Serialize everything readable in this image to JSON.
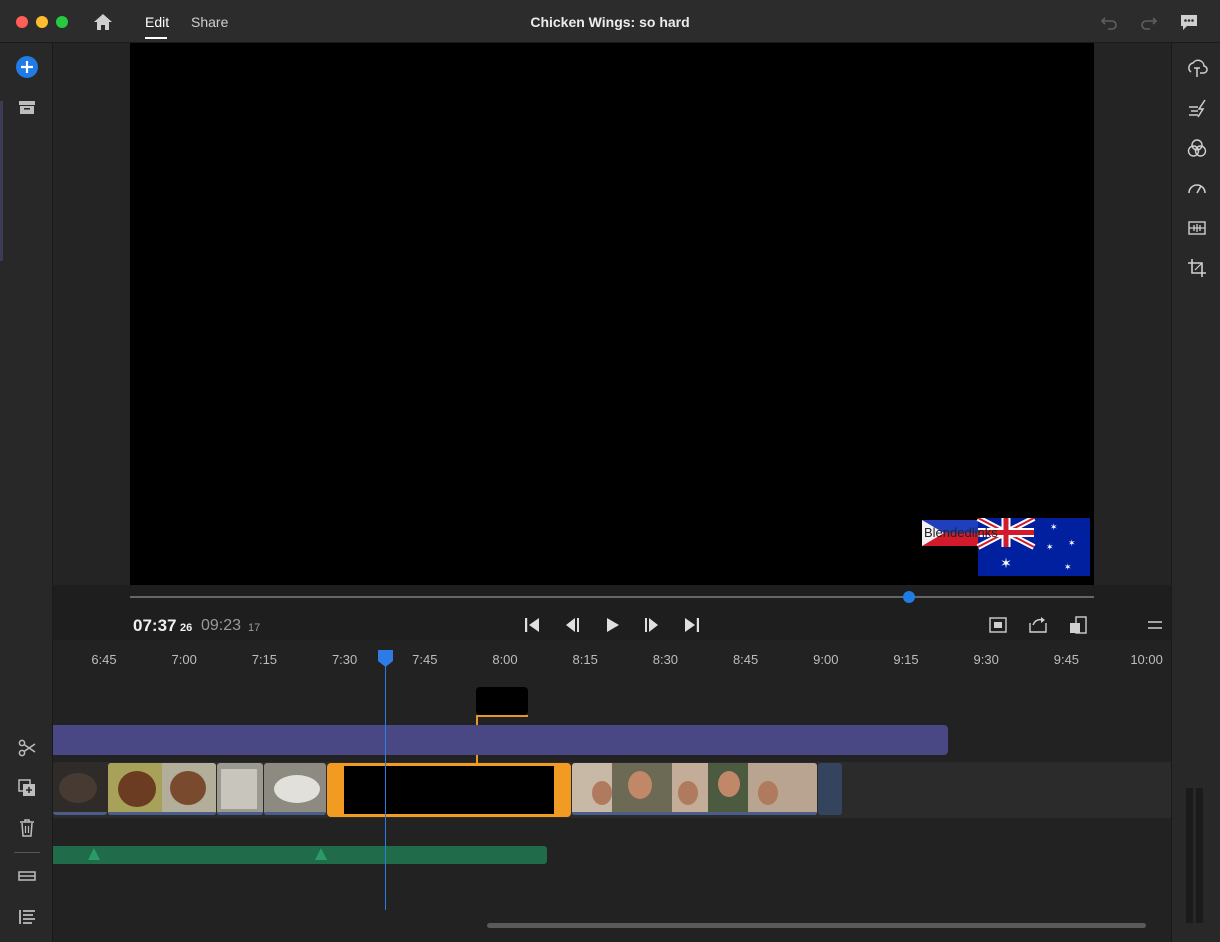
{
  "window": {
    "title": "Chicken Wings: so hard",
    "tabs": [
      {
        "label": "Edit",
        "active": true
      },
      {
        "label": "Share",
        "active": false
      }
    ]
  },
  "colors": {
    "accent": "#1f7be5",
    "selection": "#f29b23",
    "title_track": "#4a4785",
    "audio_track": "#1f6b4a"
  },
  "titlebar_icons": [
    "home-icon",
    "undo-icon",
    "redo-icon",
    "feedback-icon"
  ],
  "left_toolbar": [
    "add-media-icon",
    "project-assets-icon",
    "split-icon",
    "duplicate-icon",
    "delete-icon",
    "track-height-icon",
    "track-list-icon"
  ],
  "right_toolbar": [
    "titles-icon",
    "transitions-icon",
    "color-icon",
    "speed-icon",
    "audio-icon",
    "crop-icon"
  ],
  "monitor": {
    "overlay_text": "Blendedlinks",
    "playhead_fraction": 0.8
  },
  "transport": {
    "current_time": "07:37",
    "current_frames": "26",
    "duration": "09:23",
    "duration_frames": "17",
    "buttons": [
      "go-to-start-icon",
      "step-back-icon",
      "play-icon",
      "step-forward-icon",
      "go-to-end-icon"
    ],
    "view_buttons": [
      "fit-icon",
      "export-frame-icon",
      "monitor-size-icon",
      "menu-icon"
    ]
  },
  "timeline": {
    "ruler": [
      "6:45",
      "7:00",
      "7:15",
      "7:30",
      "7:45",
      "8:00",
      "8:15",
      "8:30",
      "8:45",
      "9:00",
      "9:15",
      "9:30",
      "9:45",
      "10:00"
    ]
  }
}
